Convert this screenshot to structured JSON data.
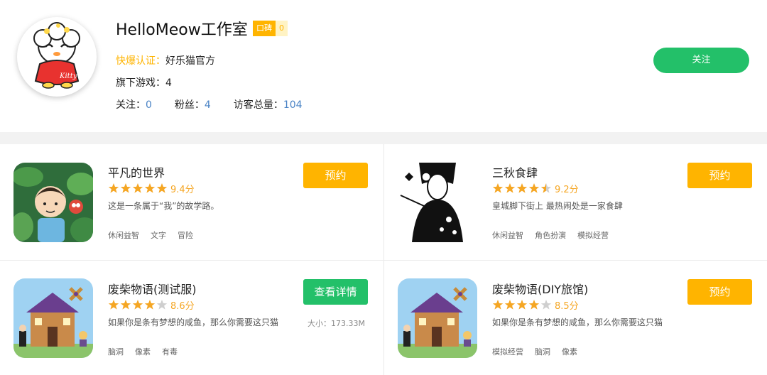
{
  "studio": {
    "name": "HelloMeow工作室",
    "reputation_label": "口碑",
    "reputation_value": "0",
    "verify_label": "快爆认证：",
    "verify_value": "好乐猫官方",
    "games_label": "旗下游戏：",
    "games_value": "4",
    "following_label": "关注：",
    "following_value": "0",
    "fans_label": "粉丝：",
    "fans_value": "4",
    "visitors_label": "访客总量：",
    "visitors_value": "104",
    "follow_button": "关注",
    "avatar_icon": "cartoon-cat-avatar",
    "avatar_text": "Kitty"
  },
  "games": [
    {
      "title": "平凡的世界",
      "rating_stars": 5,
      "score": "9.4分",
      "desc": "这是一条属于“我”的故学路。",
      "tags": [
        "休闲益智",
        "文字",
        "冒险"
      ],
      "button": "预约",
      "button_type": "reserve",
      "icon": "boy-in-jungle-icon"
    },
    {
      "title": "三秋食肆",
      "rating_stars": 4.5,
      "score": "9.2分",
      "desc": "皇城脚下街上 最热闹处是一家食肆",
      "tags": [
        "休闲益智",
        "角色扮演",
        "模拟经营"
      ],
      "button": "预约",
      "button_type": "reserve",
      "icon": "lady-with-pipe-icon"
    },
    {
      "title": "废柴物语(测试服)",
      "rating_stars": 4,
      "score": "8.6分",
      "desc": "如果你是条有梦想的咸鱼，那么你需要这只猫",
      "tags": [
        "脑洞",
        "像素",
        "有毒"
      ],
      "button": "查看详情",
      "button_type": "detail",
      "size": "大小：173.33M",
      "icon": "windmill-house-icon"
    },
    {
      "title": "废柴物语(DIY旅馆)",
      "rating_stars": 4,
      "score": "8.5分",
      "desc": "如果你是条有梦想的咸鱼，那么你需要这只猫",
      "tags": [
        "模拟经营",
        "脑洞",
        "像素"
      ],
      "button": "预约",
      "button_type": "reserve",
      "icon": "windmill-house-icon"
    }
  ],
  "colors": {
    "accent_orange": "#ffb400",
    "accent_green": "#23c069",
    "star_gold": "#f5a623",
    "link_blue": "#4a83c5"
  }
}
